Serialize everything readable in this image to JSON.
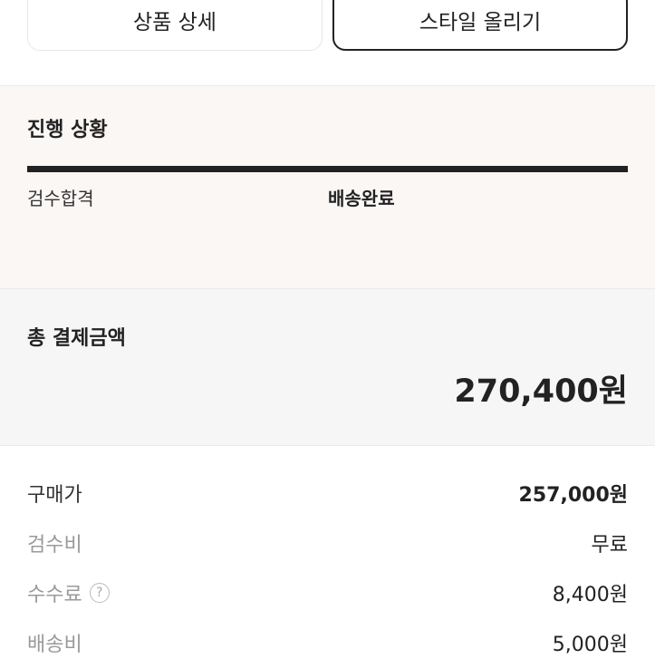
{
  "buttons": {
    "product_detail": "상품 상세",
    "upload_style": "스타일 올리기"
  },
  "progress": {
    "title": "진행 상황",
    "step_left": "검수합격",
    "step_right": "배송완료"
  },
  "total": {
    "title": "총 결제금액",
    "amount": "270,400원"
  },
  "breakdown": [
    {
      "label": "구매가",
      "value": "257,000원"
    },
    {
      "label": "검수비",
      "value": "무료"
    },
    {
      "label": "수수료",
      "value": "8,400원",
      "help_icon": "question-circle-icon"
    },
    {
      "label": "배송비",
      "value": "5,000원"
    }
  ]
}
